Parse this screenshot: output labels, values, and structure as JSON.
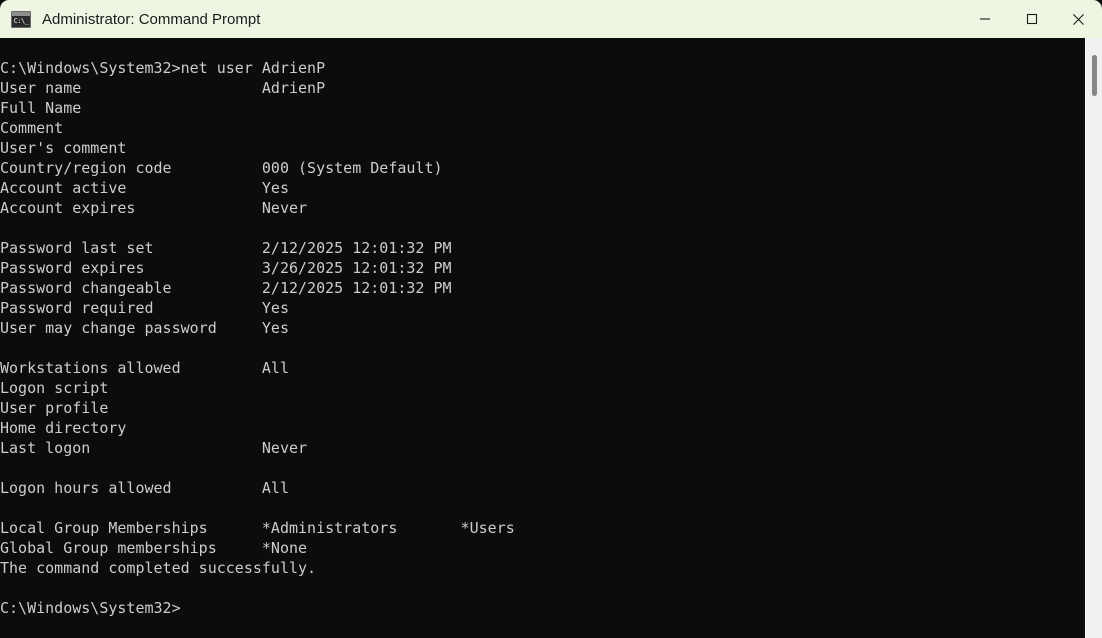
{
  "window": {
    "title": "Administrator: Command Prompt",
    "icon": "cmd-prompt-icon",
    "icon_glyph": "C:\\_",
    "titlebar_bg": "#eef6e3",
    "terminal_bg": "#0c0c0c",
    "terminal_fg": "#cccccc"
  },
  "caption_buttons": {
    "minimize": "minimize-icon",
    "maximize": "maximize-icon",
    "close": "close-icon"
  },
  "scrollbar": {
    "track_color": "#f0f0f0",
    "thumb_color": "#878787"
  },
  "terminal": {
    "prompt": "C:\\Windows\\System32>",
    "command": "net user AdrienP",
    "current_prompt": "C:\\Windows\\System32>",
    "status_line": "The command completed successfully.",
    "fields": [
      {
        "label": "User name",
        "value": "AdrienP"
      },
      {
        "label": "Full Name",
        "value": ""
      },
      {
        "label": "Comment",
        "value": ""
      },
      {
        "label": "User's comment",
        "value": ""
      },
      {
        "label": "Country/region code",
        "value": "000 (System Default)"
      },
      {
        "label": "Account active",
        "value": "Yes"
      },
      {
        "label": "Account expires",
        "value": "Never"
      },
      {
        "label": "Password last set",
        "value": "2/12/2025 12:01:32 PM"
      },
      {
        "label": "Password expires",
        "value": "3/26/2025 12:01:32 PM"
      },
      {
        "label": "Password changeable",
        "value": "2/12/2025 12:01:32 PM"
      },
      {
        "label": "Password required",
        "value": "Yes"
      },
      {
        "label": "User may change password",
        "value": "Yes"
      },
      {
        "label": "Workstations allowed",
        "value": "All"
      },
      {
        "label": "Logon script",
        "value": ""
      },
      {
        "label": "User profile",
        "value": ""
      },
      {
        "label": "Home directory",
        "value": ""
      },
      {
        "label": "Last logon",
        "value": "Never"
      },
      {
        "label": "Logon hours allowed",
        "value": "All"
      },
      {
        "label": "Local Group Memberships",
        "value": "*Administrators       *Users"
      },
      {
        "label": "Global Group memberships",
        "value": "*None"
      }
    ],
    "output": "C:\\Windows\\System32>net user AdrienP\nUser name                    AdrienP\nFull Name\nComment\nUser's comment\nCountry/region code          000 (System Default)\nAccount active               Yes\nAccount expires              Never\n\nPassword last set            2/12/2025 12:01:32 PM\nPassword expires             3/26/2025 12:01:32 PM\nPassword changeable          2/12/2025 12:01:32 PM\nPassword required            Yes\nUser may change password     Yes\n\nWorkstations allowed         All\nLogon script\nUser profile\nHome directory\nLast logon                   Never\n\nLogon hours allowed          All\n\nLocal Group Memberships      *Administrators       *Users\nGlobal Group memberships     *None\nThe command completed successfully.\n\nC:\\Windows\\System32>"
  }
}
